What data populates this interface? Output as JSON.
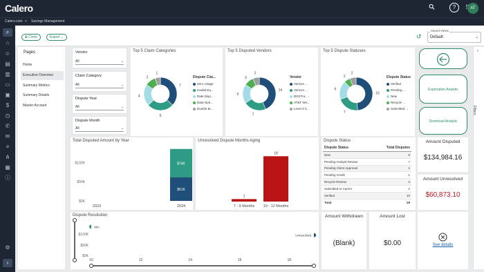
{
  "header": {
    "logo": "Calero",
    "breadcrumb_home": "Calero.com",
    "breadcrumb_sep": ">",
    "breadcrumb_page": "Savings Management",
    "avatar_initials": "AT"
  },
  "toolbar": {
    "clone_label": "Clone",
    "export_label": "Export",
    "saved_views_label": "Saved Views",
    "saved_views_value": "Default"
  },
  "pages": {
    "title": "Pages",
    "items": [
      "Home",
      "Executive Overview",
      "Summary Metrics",
      "Summary Details",
      "Master Account"
    ],
    "active_index": 1
  },
  "filters": [
    {
      "label": "Vendor",
      "value": "All"
    },
    {
      "label": "Claim Category",
      "value": "All"
    },
    {
      "label": "Dispute Year",
      "value": "All"
    },
    {
      "label": "Dispute Month",
      "value": "All"
    }
  ],
  "filters_tab_label": "Filters",
  "claim_categories": {
    "title": "Top 5 Claim Categories",
    "legend_title": "Dispute Clai...",
    "items": [
      "Zero Usage",
      "Invalid Eq...",
      "Rate Disp...",
      "Data Opti...",
      "Double Bi..."
    ],
    "values": [
      7,
      5,
      4,
      2,
      1
    ],
    "colors": [
      "#1f4e79",
      "#2e9c84",
      "#a3dbe6",
      "#4caf50",
      "#9e9e9e"
    ],
    "value_labels": [
      "7",
      "5",
      "4",
      "2",
      "1"
    ]
  },
  "disputed_vendors": {
    "title": "Top 5 Disputed Vendors",
    "legend_title": "Vendor",
    "items": [
      "Verizon ...",
      "Verizon ...",
      "DIGITAL ...",
      "AT&T Wir...",
      "Level 3 C..."
    ],
    "values": [
      14,
      7,
      6,
      3,
      2
    ],
    "colors": [
      "#1f4e79",
      "#2e9c84",
      "#a3dbe6",
      "#4caf50",
      "#9e9e9e"
    ],
    "value_labels": [
      "14",
      "7",
      "6",
      "3",
      "2"
    ]
  },
  "dispute_statuses": {
    "title": "Top 5 Dispute Statuses",
    "legend_title": "Dispute Status",
    "items": [
      "Verified",
      "Pending ...",
      "New",
      "Recycle ...",
      "Submitted ..."
    ],
    "values": [
      16,
      7,
      6,
      2,
      2
    ],
    "colors": [
      "#1f4e79",
      "#2e9c84",
      "#a3dbe6",
      "#4caf50",
      "#9e9e9e"
    ],
    "value_labels": [
      "16",
      "7",
      "6",
      "2",
      "2"
    ]
  },
  "kpis": {
    "amount_disputed_title": "Amount Disputed",
    "amount_disputed": "$134,984.16",
    "amount_unresolved_title": "Amount Unresolved",
    "amount_unresolved": "$60,873.10",
    "amount_withdrawn_title": "Amount Withdrawn",
    "amount_withdrawn": "(Blank)",
    "amount_lost_title": "Amount Lost",
    "amount_lost": "$0.00",
    "see_details": "See details"
  },
  "actions": {
    "exploration": "Exploration Analytic",
    "download": "Download Analytic"
  },
  "dispute_status_table": {
    "title": "Dispute Status",
    "headers": [
      "Dispute Status",
      "Total Disputes"
    ],
    "rows": [
      [
        "New",
        "6"
      ],
      [
        "Pending Analyst Review",
        "7"
      ],
      [
        "Pending Client Approval",
        "1"
      ],
      [
        "Pending Credit",
        "1"
      ],
      [
        "Recycle Review",
        "2"
      ],
      [
        "Submitted to Carrier",
        "2"
      ],
      [
        "Verified",
        "10"
      ],
      [
        "Total",
        "29"
      ]
    ]
  },
  "colors": {
    "accent": "#2e8b6b",
    "navy": "#1f2633",
    "red": "#c0141c"
  },
  "chart_data": [
    {
      "type": "bar",
      "title": "Total Disputed Amount by Year",
      "categories": [
        "2023",
        "2024"
      ],
      "series": [
        {
          "values": [
            0,
            61
          ],
          "color": "#1f4e79",
          "data_labels": [
            "",
            "$61K"
          ]
        },
        {
          "values": [
            0,
            74
          ],
          "color": "#2e9c84",
          "data_labels": [
            "",
            "$74K"
          ]
        }
      ],
      "yticks": [
        "$0K",
        "$50K",
        "$100K"
      ],
      "ylim": [
        0,
        140
      ]
    },
    {
      "type": "bar",
      "title": "Unresolved Dispute Months Aging",
      "categories": [
        "7 - 9 Months",
        "10 - 12 Months"
      ],
      "values": [
        1,
        18
      ],
      "data_labels": [
        "1",
        "18"
      ],
      "ylim": [
        0,
        20
      ]
    },
    {
      "type": "line",
      "title": "Dispute Resolution",
      "xticks": [
        "10",
        "12",
        "14",
        "16",
        "18"
      ],
      "yticks": [
        "$0K",
        "$50K",
        "$100K"
      ],
      "series": [
        {
          "name": "Win",
          "x": [
            10
          ],
          "y": [
            85
          ]
        },
        {
          "name": "Unresolved",
          "x": [
            19
          ],
          "y": [
            60
          ]
        }
      ],
      "xlim": [
        10,
        19
      ],
      "ylim": [
        0,
        100
      ]
    }
  ]
}
